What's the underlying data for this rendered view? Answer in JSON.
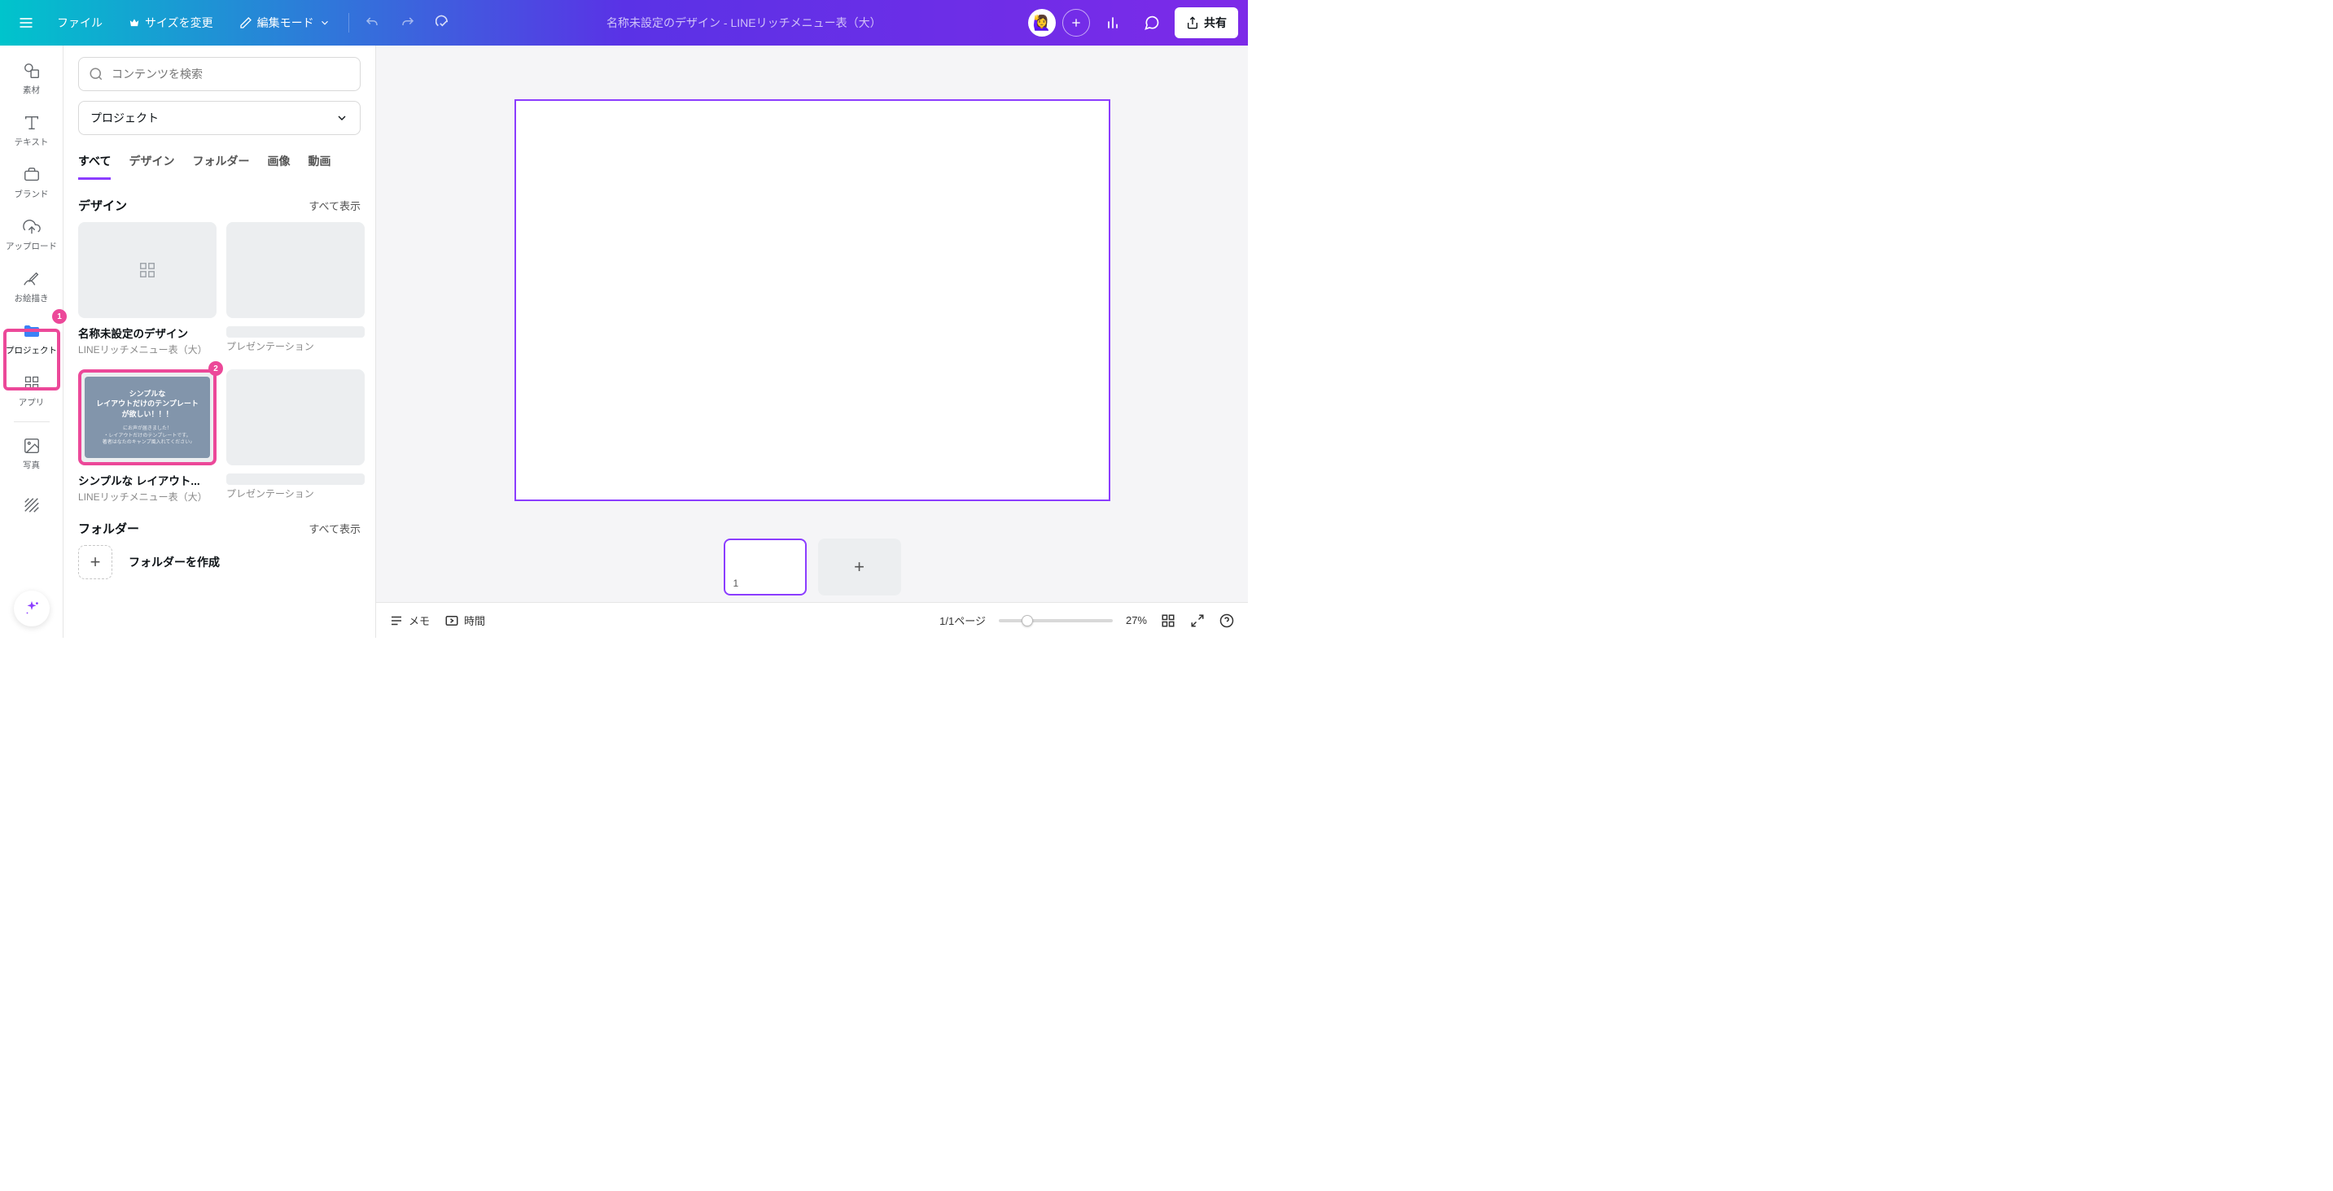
{
  "header": {
    "file": "ファイル",
    "resize": "サイズを変更",
    "edit_mode": "編集モード",
    "design_title": "名称未設定のデザイン - LINEリッチメニュー表（大）",
    "share": "共有"
  },
  "nav": {
    "elements": "素材",
    "text": "テキスト",
    "brand": "ブランド",
    "upload": "アップロード",
    "draw": "お絵描き",
    "projects": "プロジェクト",
    "apps": "アプリ",
    "photos": "写真",
    "badge1": "1",
    "badge2": "2"
  },
  "panel": {
    "search_placeholder": "コンテンツを検索",
    "project_select": "プロジェクト",
    "tabs": {
      "all": "すべて",
      "design": "デザイン",
      "folder": "フォルダー",
      "image": "画像",
      "video": "動画"
    },
    "section_design": "デザイン",
    "show_all": "すべて表示",
    "card1_title": "名称未設定のデザイン",
    "card1_sub": "LINEリッチメニュー表（大）",
    "card2_sub": "プレゼンテーション",
    "card3_title": "シンプルな レイアウト...",
    "card3_sub": "LINEリッチメニュー表（大）",
    "card3_inner_l1": "シンプルな",
    "card3_inner_l2": "レイアウトだけのテンプレート",
    "card3_inner_l3": "が欲しい！！！",
    "card4_sub": "プレゼンテーション",
    "section_folder": "フォルダー",
    "folder_create": "フォルダーを作成"
  },
  "bottombar": {
    "notes": "メモ",
    "time": "時間",
    "page_count": "1/1ページ",
    "zoom": "27%"
  },
  "page_strip": {
    "num": "1"
  }
}
